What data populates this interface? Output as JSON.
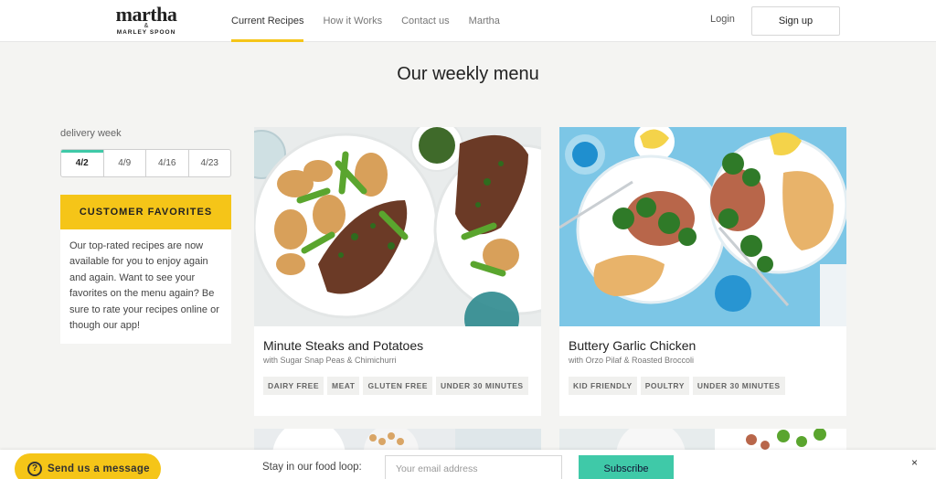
{
  "header": {
    "logo_main": "martha",
    "logo_amp": "&",
    "logo_sub": "MARLEY SPOON",
    "nav": [
      "Current Recipes",
      "How it Works",
      "Contact us",
      "Martha"
    ],
    "login_label": "Login",
    "signup_label": "Sign up"
  },
  "page_title": "Our weekly menu",
  "sidebar": {
    "delivery_label": "delivery week",
    "weeks": [
      "4/2",
      "4/9",
      "4/16",
      "4/23"
    ],
    "selected_week": "4/2",
    "favorites_title": "CUSTOMER FAVORITES",
    "favorites_text": "Our top-rated recipes are now available for you to enjoy again and again. Want to see your favorites on the menu again? Be sure to rate your recipes online or though our app!"
  },
  "recipes": [
    {
      "title": "Minute Steaks and Potatoes",
      "subtitle": "with Sugar Snap Peas & Chimichurri",
      "tags": [
        "DAIRY FREE",
        "MEAT",
        "GLUTEN FREE",
        "UNDER 30 MINUTES"
      ]
    },
    {
      "title": "Buttery Garlic Chicken",
      "subtitle": "with Orzo Pilaf & Roasted Broccoli",
      "tags": [
        "KID FRIENDLY",
        "POULTRY",
        "UNDER 30 MINUTES"
      ]
    }
  ],
  "footer": {
    "send_message_label": "Send us a message",
    "send_icon": "question-icon",
    "loop_label": "Stay in our food loop:",
    "email_placeholder": "Your email address",
    "subscribe_label": "Subscribe",
    "close_icon": "close-icon",
    "close_glyph": "×"
  },
  "colors": {
    "accent_yellow": "#f5c518",
    "accent_teal": "#3fc9a8",
    "background": "#f4f4f2"
  }
}
